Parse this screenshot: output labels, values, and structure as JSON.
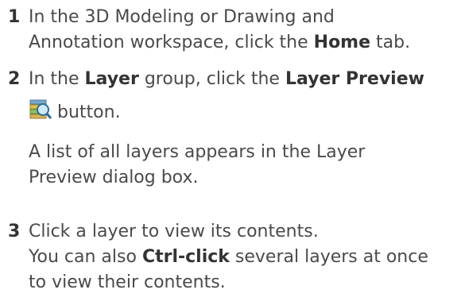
{
  "steps": [
    {
      "number": "1",
      "line1": "In the 3D Modeling or Drawing and",
      "line2a": "Annotation workspace, click the ",
      "line2b": "Home",
      "line2c": " tab."
    },
    {
      "number": "2",
      "line1a": "In the ",
      "line1b": "Layer",
      "line1c": " group, click the ",
      "line1d": "Layer Preview",
      "icon": "layer-preview-icon",
      "line2": "button.",
      "para1": "A list of all layers appears in the Layer",
      "para2": "Preview dialog box."
    },
    {
      "number": "3",
      "line1": "Click a layer to view its contents.",
      "line2a": "You can also ",
      "line2b": "Ctrl-click",
      "line2c": " several layers at once",
      "line3": "to view their contents."
    }
  ]
}
